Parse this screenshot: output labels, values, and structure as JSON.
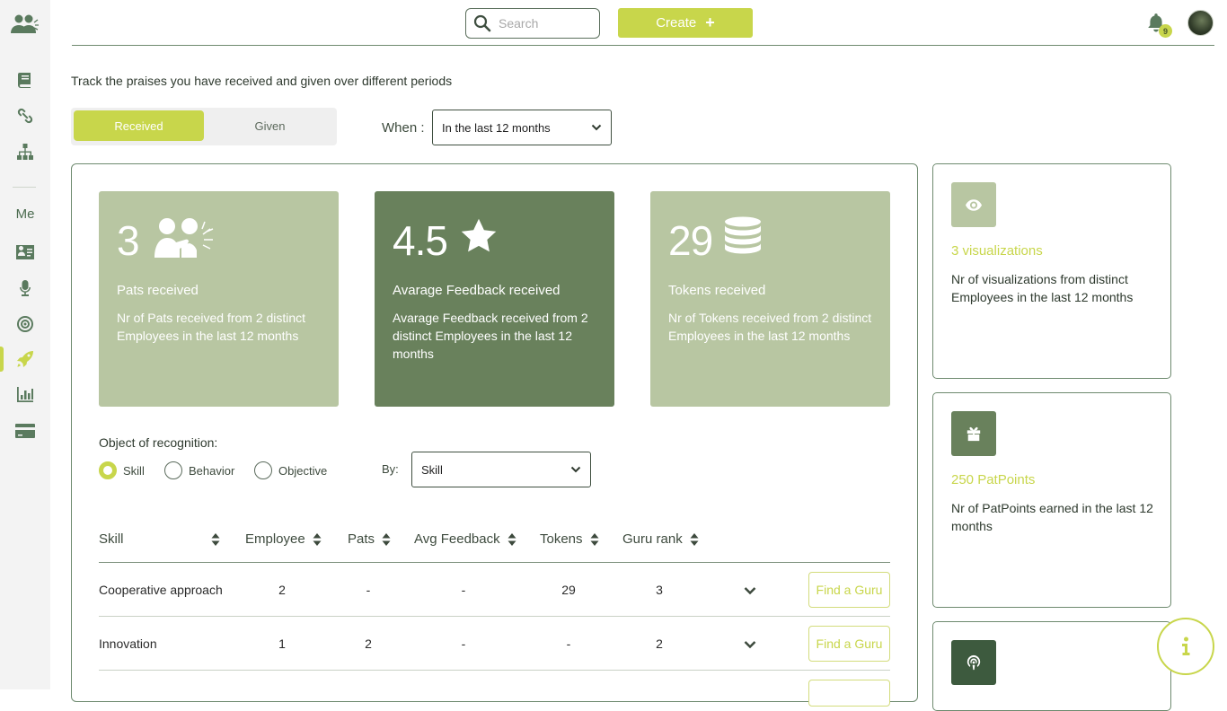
{
  "sidebar": {
    "me_label": "Me",
    "icons": [
      "users-logo-icon",
      "book-icon",
      "link-icon",
      "org-chart-icon",
      "id-card-icon",
      "microphone-icon",
      "target-icon",
      "rocket-icon",
      "bar-chart-icon",
      "credit-card-icon"
    ],
    "active": "rocket-icon"
  },
  "header": {
    "search_placeholder": "Search",
    "create_label": "Create",
    "create_icon": "+",
    "notification_count": "9"
  },
  "intro_text": "Track the praises you have received and given over different periods",
  "tabs": {
    "received": "Received",
    "given": "Given",
    "active": "Received"
  },
  "when": {
    "label": "When :",
    "value": "In the last 12 months"
  },
  "cards": [
    {
      "value": "3",
      "title": "Pats received",
      "desc": "Nr of Pats received from 2 distinct Employees in the last 12 months",
      "icon": "pat-people-icon"
    },
    {
      "value": "4.5",
      "title": "Avarage Feedback received",
      "desc": "Avarage Feedback received from 2 distinct Employees in the last 12 months",
      "icon": "star-icon"
    },
    {
      "value": "29",
      "title": "Tokens received",
      "desc": "Nr of Tokens received from 2 distinct Employees in the last 12 months",
      "icon": "coins-stack-icon"
    }
  ],
  "recognition": {
    "label": "Object of recognition:",
    "options": [
      "Skill",
      "Behavior",
      "Objective"
    ],
    "selected": "Skill",
    "by_label": "By:",
    "by_value": "Skill"
  },
  "table": {
    "columns": [
      "Skill",
      "Employee",
      "Pats",
      "Avg Feedback",
      "Tokens",
      "Guru rank"
    ],
    "rows": [
      {
        "skill": "Cooperative approach",
        "employee": "2",
        "pats": "-",
        "avg_feedback": "-",
        "tokens": "29",
        "guru_rank": "3",
        "action": "Find a Guru"
      },
      {
        "skill": "Innovation",
        "employee": "1",
        "pats": "2",
        "avg_feedback": "-",
        "tokens": "-",
        "guru_rank": "2",
        "action": "Find a Guru"
      }
    ]
  },
  "side": [
    {
      "title": "3 visualizations",
      "desc": "Nr of visualizations from distinct Employees in the last 12 months",
      "icon": "eye-icon"
    },
    {
      "title": "250 PatPoints",
      "desc": "Nr of PatPoints earned in the last 12 months",
      "icon": "gift-icon"
    },
    {
      "title": "",
      "desc": "",
      "icon": "podcast-icon"
    }
  ],
  "colors": {
    "accent": "#c8d64b",
    "card_light": "#b8c6a2",
    "card_dark": "#69815c",
    "border": "#6e8a6f"
  }
}
